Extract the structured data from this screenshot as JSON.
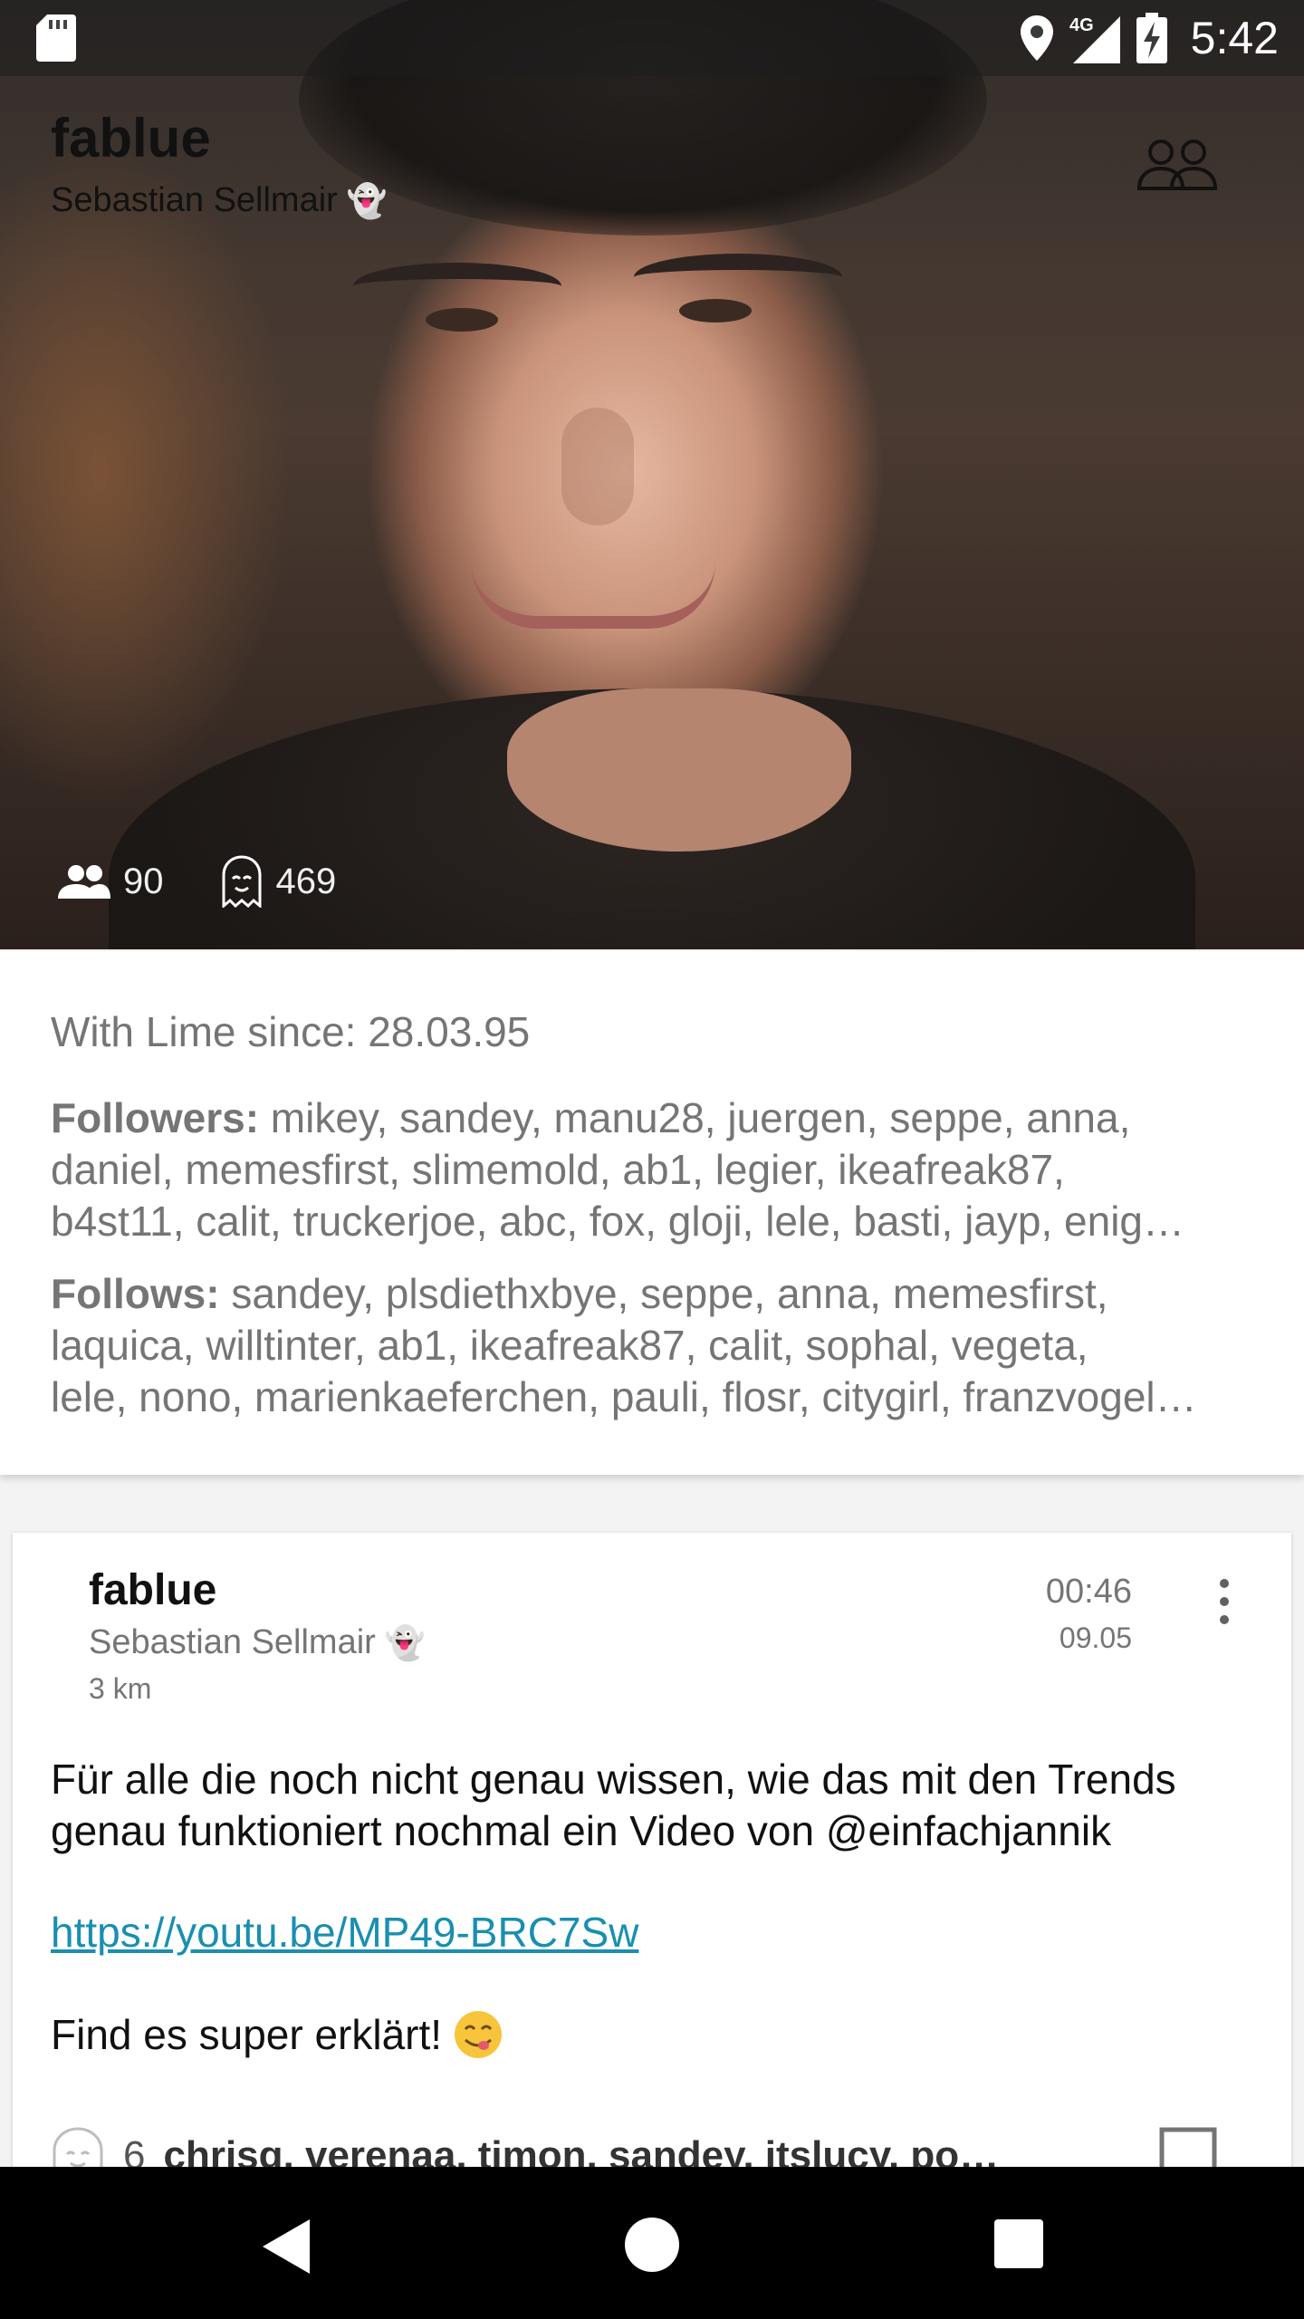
{
  "status_bar": {
    "time": "5:42",
    "network": "4G",
    "icons": [
      "sd-card-icon",
      "location-icon",
      "signal-icon",
      "battery-charging-icon"
    ]
  },
  "profile": {
    "username": "fablue",
    "full_name": "Sebastian Sellmair",
    "ghost_emoji": "👻",
    "friends_count": "90",
    "ghost_count": "469",
    "since_label": "With Lime since: 28.03.95",
    "followers_label": "Followers:",
    "followers_lines": [
      " mikey, sandey, manu28, juergen, seppe, anna,",
      "daniel, memesfirst, slimemold, ab1, legier, ikeafreak87,",
      "b4st11, calit, truckerjoe, abc, fox, gloji, lele, basti, jayp, enig…"
    ],
    "follows_label": "Follows:",
    "follows_lines": [
      " sandey, plsdiethxbye, seppe, anna, memesfirst,",
      "laquica, willtinter, ab1, ikeafreak87, calit, sophal, vegeta,",
      "lele, nono, marienkaeferchen, pauli, flosr, citygirl, franzvogel…"
    ]
  },
  "post": {
    "username": "fablue",
    "full_name": "Sebastian Sellmair",
    "ghost_emoji": "👻",
    "distance": "3 km",
    "time": "00:46",
    "date": "09.05",
    "text": "Für alle die noch nicht genau wissen, wie das mit den Trends genau funktioniert nochmal ein Video von @einfachjannik",
    "link": "https://youtu.be/MP49-BRC7Sw",
    "closing": "Find es super erklärt!",
    "likes_count": "6",
    "likes_names": "chrisg, verenaa, timon, sandey, itslucy, po…"
  },
  "colors": {
    "link": "#1a8fb0",
    "secondary_text": "#757575",
    "nav_bar": "#000000"
  }
}
